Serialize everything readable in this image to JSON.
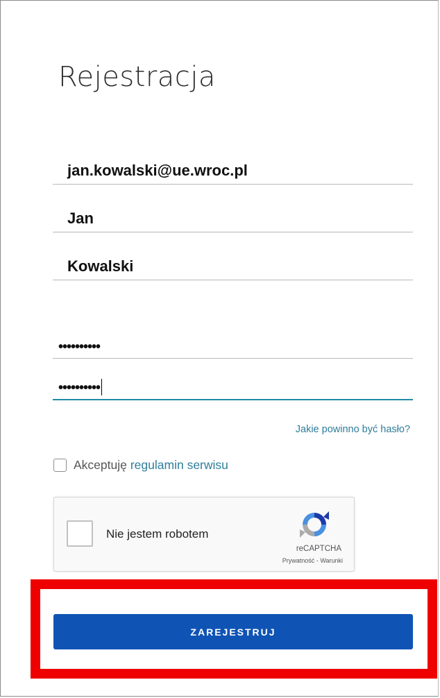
{
  "form": {
    "title": "Rejestracja",
    "email_value": "jan.kowalski@ue.wroc.pl",
    "first_name_value": "Jan",
    "last_name_value": "Kowalski",
    "password_value": "••••••••••",
    "password_confirm_value": "••••••••••",
    "password_hint_link": "Jakie powinno być hasło?",
    "terms_prefix": "Akceptuję",
    "terms_link": "regulamin serwisu",
    "submit_label": "ZAREJESTRUJ"
  },
  "recaptcha": {
    "label": "Nie jestem robotem",
    "brand": "reCAPTCHA",
    "privacy_link": "Prywatność",
    "separator": " - ",
    "terms_link": "Warunki",
    "icon": "recaptcha-logo-icon"
  },
  "colors": {
    "accent_link": "#2e7d9a",
    "focus_underline": "#1e8ba3",
    "submit_button": "#0f54b4",
    "highlight": "#ee0000"
  }
}
